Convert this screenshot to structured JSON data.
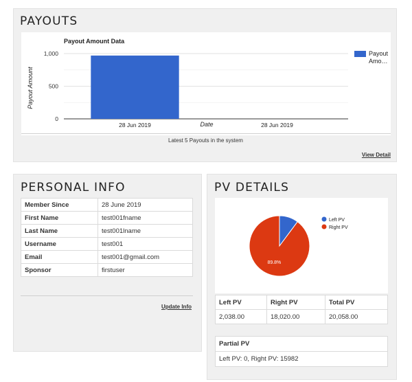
{
  "payouts": {
    "title": "PAYOUTS",
    "caption": "Latest 5 Payouts in the system",
    "view_detail": "View Detail"
  },
  "chart_data": [
    {
      "type": "bar",
      "title": "Payout Amount Data",
      "xlabel": "Date",
      "ylabel": "Payout Amount",
      "categories": [
        "28 Jun 2019",
        "28 Jun 2019"
      ],
      "series": [
        {
          "name": "Payout Amo…",
          "values": [
            970,
            0
          ]
        }
      ],
      "ylim": [
        0,
        1000
      ],
      "yticks": [
        "0",
        "500",
        "1,000"
      ],
      "grid": true,
      "legend": "right",
      "colors": {
        "bar": "#3366cc"
      }
    },
    {
      "type": "pie",
      "labels": [
        "Left PV",
        "Right PV"
      ],
      "values": [
        10.2,
        89.8
      ],
      "data_labels": [
        "",
        "89.8%"
      ],
      "legend": "right",
      "colors": [
        "#3366cc",
        "#dc3912"
      ]
    }
  ],
  "personal": {
    "title": "PERSONAL INFO",
    "rows": [
      {
        "k": "Member Since",
        "v": "28 June 2019"
      },
      {
        "k": "First Name",
        "v": "test001fname"
      },
      {
        "k": "Last Name",
        "v": "test001lname"
      },
      {
        "k": "Username",
        "v": "test001"
      },
      {
        "k": "Email",
        "v": "test001@gmail.com"
      },
      {
        "k": "Sponsor",
        "v": "firstuser"
      }
    ],
    "update": "Update Info"
  },
  "pv": {
    "title": "PV DETAILS",
    "headers": [
      "Left PV",
      "Right PV",
      "Total PV"
    ],
    "values": [
      "2,038.00",
      "18,020.00",
      "20,058.00"
    ],
    "partial_title": "Partial PV",
    "partial_value": "Left PV: 0, Right PV: 15982"
  }
}
